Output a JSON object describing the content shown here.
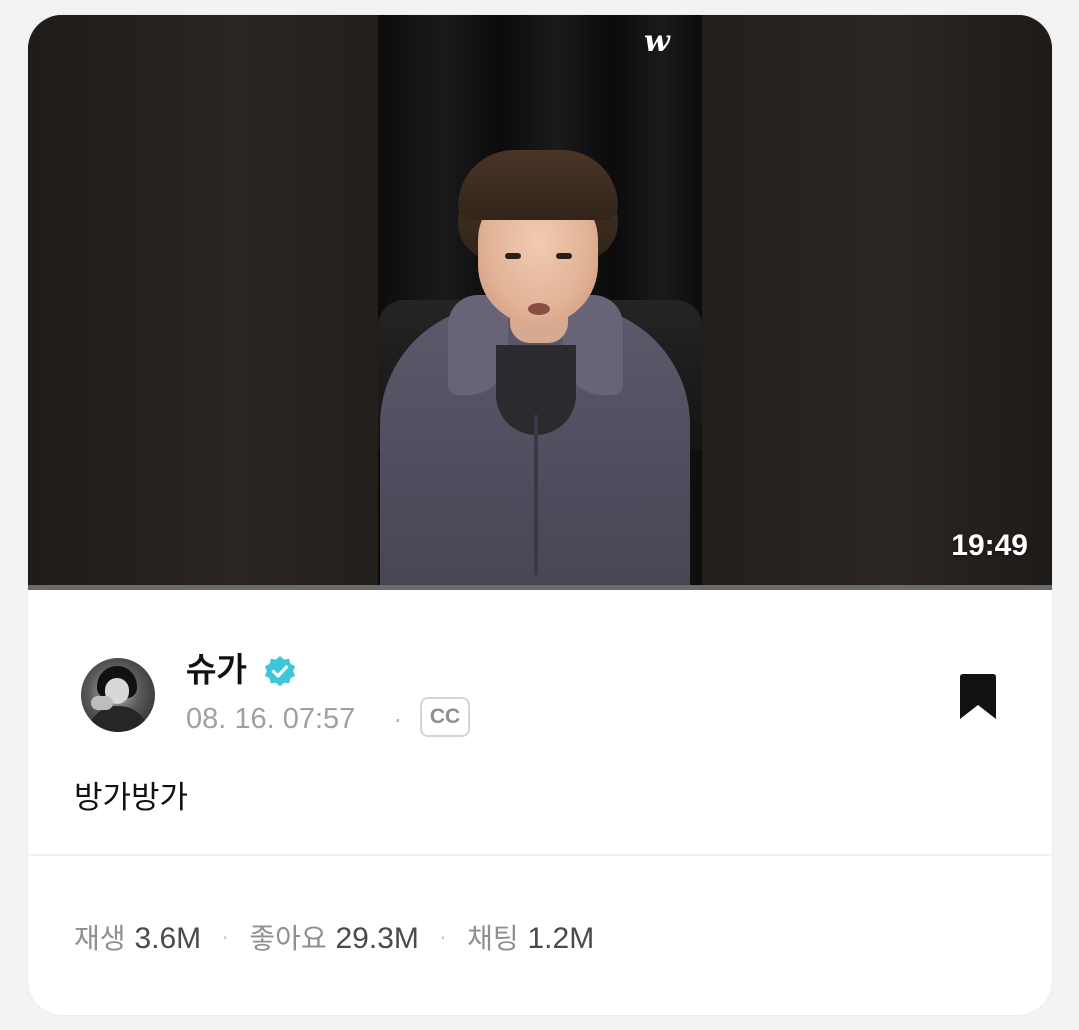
{
  "video": {
    "watermark": "w",
    "duration": "19:49",
    "progress": 0
  },
  "post": {
    "author": "슈가",
    "verified": true,
    "date": "08. 16. 07:57",
    "separator": "·",
    "cc_label": "CC",
    "text": "방가방가"
  },
  "stats": {
    "separator": "·",
    "items": [
      {
        "label": "재생",
        "value": "3.6M"
      },
      {
        "label": "좋아요",
        "value": "29.3M"
      },
      {
        "label": "채팅",
        "value": "1.2M"
      }
    ]
  },
  "colors": {
    "verified_badge": "#3cc6d6",
    "bookmark": "#111111",
    "background": "#f3f3f3"
  },
  "icons": {
    "verified": "verified-badge-icon",
    "bookmark": "bookmark-icon",
    "closed_captions": "cc-icon"
  }
}
